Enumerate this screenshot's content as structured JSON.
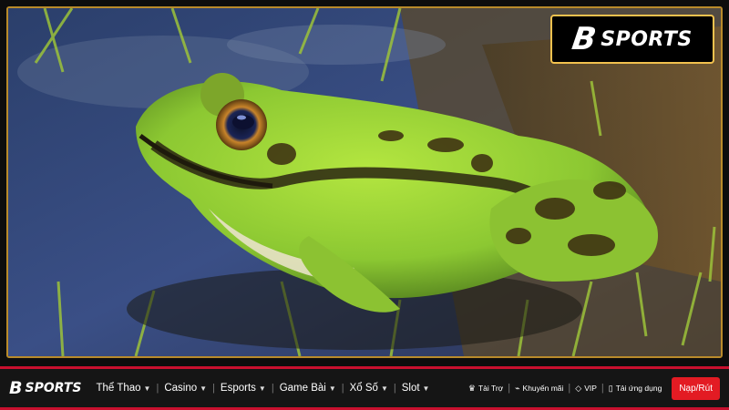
{
  "brand": {
    "logo_mark": "B",
    "logo_word": "SPORTS"
  },
  "hero": {
    "image": "frog-in-water-photo"
  },
  "nav": {
    "menu": [
      {
        "label": "Thể Thao"
      },
      {
        "label": "Casino"
      },
      {
        "label": "Esports"
      },
      {
        "label": "Game Bài"
      },
      {
        "label": "Xổ Số"
      },
      {
        "label": "Slot"
      }
    ],
    "utilities": [
      {
        "label": "Tài Trợ",
        "icon": "trophy-icon"
      },
      {
        "label": "Khuyến mãi",
        "icon": "tag-icon"
      },
      {
        "label": "VIP",
        "icon": "diamond-icon"
      },
      {
        "label": "Tải ứng dụng",
        "icon": "phone-icon"
      }
    ],
    "cta_label": "Nạp/Rút"
  },
  "colors": {
    "accent_red": "#e31b23",
    "nav_border": "#c8102e",
    "gold_border": "#f2c14e",
    "nav_bg": "#151515"
  }
}
